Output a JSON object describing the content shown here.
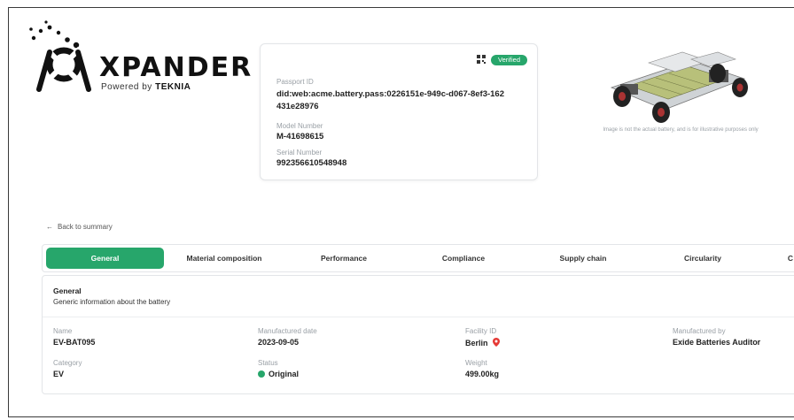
{
  "brand": {
    "word": "XPANDER",
    "powered_by": "Powered by",
    "partner": "TEKNIA"
  },
  "passport": {
    "badge": "Verified",
    "passport_id_label": "Passport ID",
    "passport_id": "did:web:acme.battery.pass:0226151e-949c-d067-8ef3-162431e28976",
    "model_label": "Model Number",
    "model": "M-41698615",
    "serial_label": "Serial Number",
    "serial": "992356610548948"
  },
  "image_disclaimer": "Image is not the actual battery, and is for illustrative purposes only",
  "back_link": "Back to summary",
  "tabs": [
    {
      "label": "General",
      "active": true
    },
    {
      "label": "Material composition"
    },
    {
      "label": "Performance"
    },
    {
      "label": "Compliance"
    },
    {
      "label": "Supply chain"
    },
    {
      "label": "Circularity"
    },
    {
      "label": "C"
    }
  ],
  "general": {
    "title": "General",
    "description": "Generic information about the battery",
    "fields": {
      "name_label": "Name",
      "name": "EV-BAT095",
      "manufactured_date_label": "Manufactured date",
      "manufactured_date": "2023-09-05",
      "facility_label": "Facility ID",
      "facility": "Berlin",
      "manufactured_by_label": "Manufactured by",
      "manufactured_by": "Exide Batteries Auditor",
      "category_label": "Category",
      "category": "EV",
      "status_label": "Status",
      "status": "Original",
      "weight_label": "Weight",
      "weight": "499.00kg"
    }
  },
  "colors": {
    "accent": "#27a66b",
    "location_pin": "#e53935"
  }
}
